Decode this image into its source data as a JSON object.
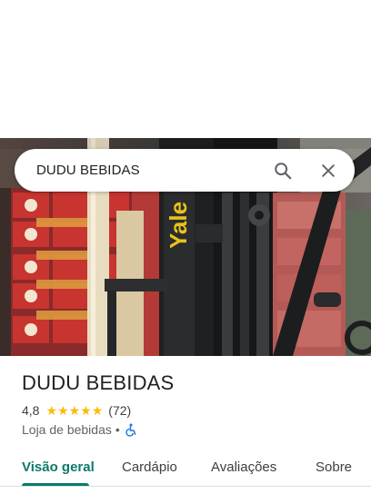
{
  "search": {
    "query": "DUDU BEBIDAS",
    "search_icon": "search-icon",
    "close_icon": "close-icon"
  },
  "hero": {
    "brand_text": "Yale"
  },
  "place": {
    "name": "DUDU BEBIDAS",
    "rating": "4,8",
    "stars": 5,
    "review_count": "(72)",
    "category": "Loja de bebidas",
    "separator": "•",
    "accessibility_icon": "wheelchair-icon"
  },
  "tabs": [
    {
      "label": "Visão geral",
      "active": true
    },
    {
      "label": "Cardápio",
      "active": false
    },
    {
      "label": "Avaliações",
      "active": false
    },
    {
      "label": "Sobre",
      "active": false
    }
  ],
  "colors": {
    "accent": "#0b7a6a",
    "star": "#fbbc04",
    "accessibility": "#1a73e8"
  }
}
